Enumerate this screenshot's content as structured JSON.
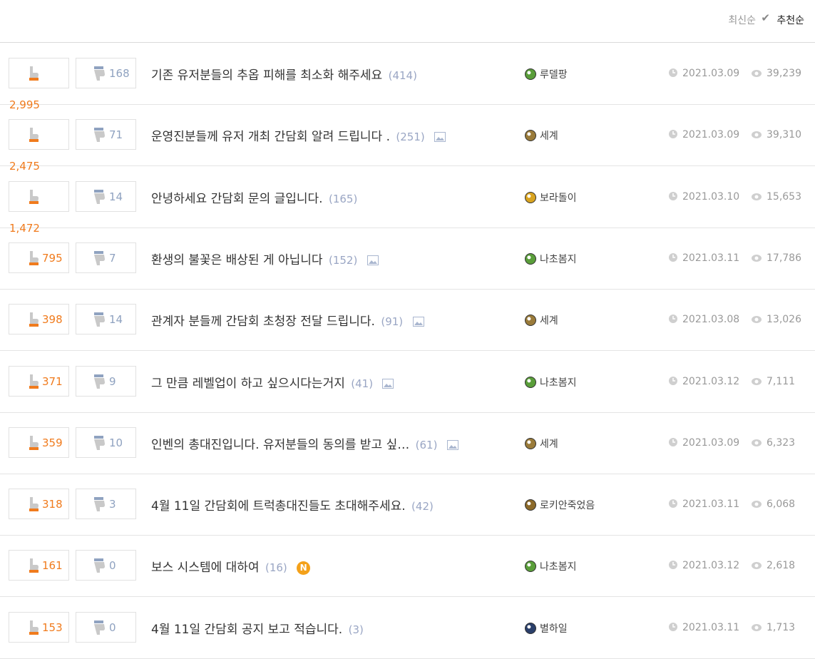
{
  "sort": {
    "latest": "최신순",
    "recommended": "추천순"
  },
  "posts": [
    {
      "likes": "",
      "likes_below": "2,995",
      "dislikes": "168",
      "title": "기존 유저분들의 추옵 피해를 최소화 해주세요",
      "comments": "(414)",
      "has_image": false,
      "is_new": false,
      "author": "루델팡",
      "badge_color": "#5a9e3a",
      "date": "2021.03.09",
      "views": "39,239"
    },
    {
      "likes": "",
      "likes_below": "2,475",
      "dislikes": "71",
      "title": "운영진분들께 유저 개최 간담회 알려 드립니다 .",
      "comments": "(251)",
      "has_image": true,
      "is_new": false,
      "author": "세계",
      "badge_color": "#9a7b3a",
      "date": "2021.03.09",
      "views": "39,310"
    },
    {
      "likes": "",
      "likes_below": "1,472",
      "dislikes": "14",
      "title": "안녕하세요 간담회 문의 글입니다.",
      "comments": "(165)",
      "has_image": false,
      "is_new": false,
      "author": "보라돌이",
      "badge_color": "#d9a420",
      "date": "2021.03.10",
      "views": "15,653"
    },
    {
      "likes": "795",
      "likes_below": "",
      "dislikes": "7",
      "title": "환생의 불꽃은 배상된 게 아닙니다",
      "comments": "(152)",
      "has_image": true,
      "is_new": false,
      "author": "나초봄지",
      "badge_color": "#5a9e3a",
      "date": "2021.03.11",
      "views": "17,786"
    },
    {
      "likes": "398",
      "likes_below": "",
      "dislikes": "14",
      "title": "관계자 분들께 간담회 초청장 전달 드립니다.",
      "comments": "(91)",
      "has_image": true,
      "is_new": false,
      "author": "세계",
      "badge_color": "#9a7b3a",
      "date": "2021.03.08",
      "views": "13,026"
    },
    {
      "likes": "371",
      "likes_below": "",
      "dislikes": "9",
      "title": "그 만큼 레벨업이 하고 싶으시다는거지",
      "comments": "(41)",
      "has_image": true,
      "is_new": false,
      "author": "나초봄지",
      "badge_color": "#5a9e3a",
      "date": "2021.03.12",
      "views": "7,111"
    },
    {
      "likes": "359",
      "likes_below": "",
      "dislikes": "10",
      "title": "인벤의 총대진입니다. 유저분들의 동의를 받고 싶…",
      "comments": "(61)",
      "has_image": true,
      "is_new": false,
      "author": "세계",
      "badge_color": "#9a7b3a",
      "date": "2021.03.09",
      "views": "6,323"
    },
    {
      "likes": "318",
      "likes_below": "",
      "dislikes": "3",
      "title": "4월 11일 간담회에 트럭총대진들도 초대해주세요.",
      "comments": "(42)",
      "has_image": false,
      "is_new": false,
      "author": "로키안죽었음",
      "badge_color": "#8c6a2a",
      "date": "2021.03.11",
      "views": "6,068"
    },
    {
      "likes": "161",
      "likes_below": "",
      "dislikes": "0",
      "title": "보스 시스템에 대하여",
      "comments": "(16)",
      "has_image": false,
      "is_new": true,
      "new_label": "N",
      "author": "나초봄지",
      "badge_color": "#5a9e3a",
      "date": "2021.03.12",
      "views": "2,618"
    },
    {
      "likes": "153",
      "likes_below": "",
      "dislikes": "0",
      "title": "4월 11일 간담회 공지 보고 적습니다.",
      "comments": "(3)",
      "has_image": false,
      "is_new": false,
      "author": "별하일",
      "badge_color": "#2a3f6a",
      "date": "2021.03.11",
      "views": "1,713"
    }
  ]
}
